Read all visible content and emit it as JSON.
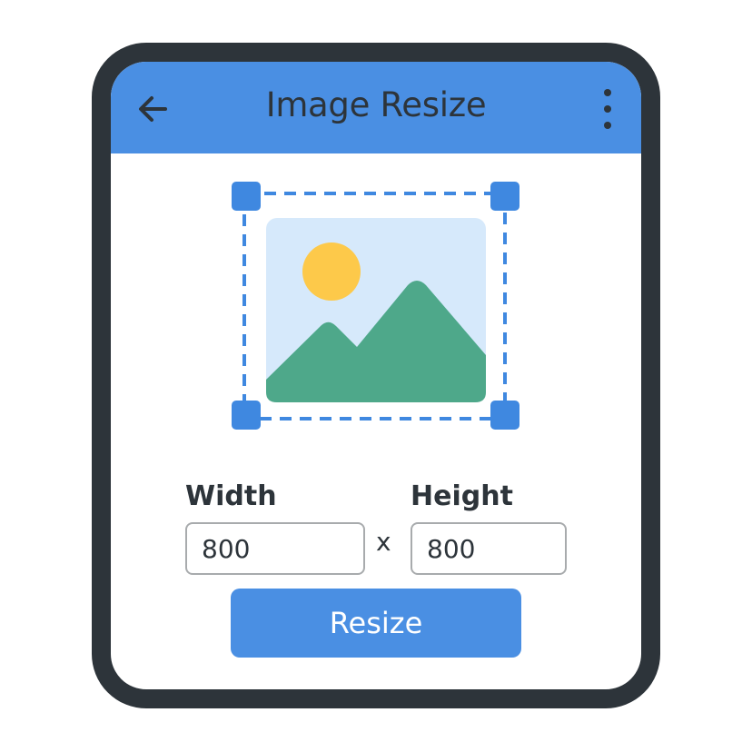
{
  "header": {
    "title": "Image Resize",
    "back_icon": "arrow-left-icon",
    "menu_icon": "more-vertical-icon"
  },
  "preview": {
    "image_icon": "landscape-image-icon",
    "selection": "dashed-crop-box-with-4-handles"
  },
  "form": {
    "width_label": "Width",
    "width_value": "800",
    "separator": "x",
    "height_label": "Height",
    "height_value": "800"
  },
  "actions": {
    "resize_label": "Resize"
  },
  "colors": {
    "accent": "#4a8fe3",
    "frame": "#2d343a",
    "sky": "#d6e9fb",
    "sun": "#fdc94a",
    "mountain": "#4ea88a",
    "handle": "#3f88e0"
  }
}
